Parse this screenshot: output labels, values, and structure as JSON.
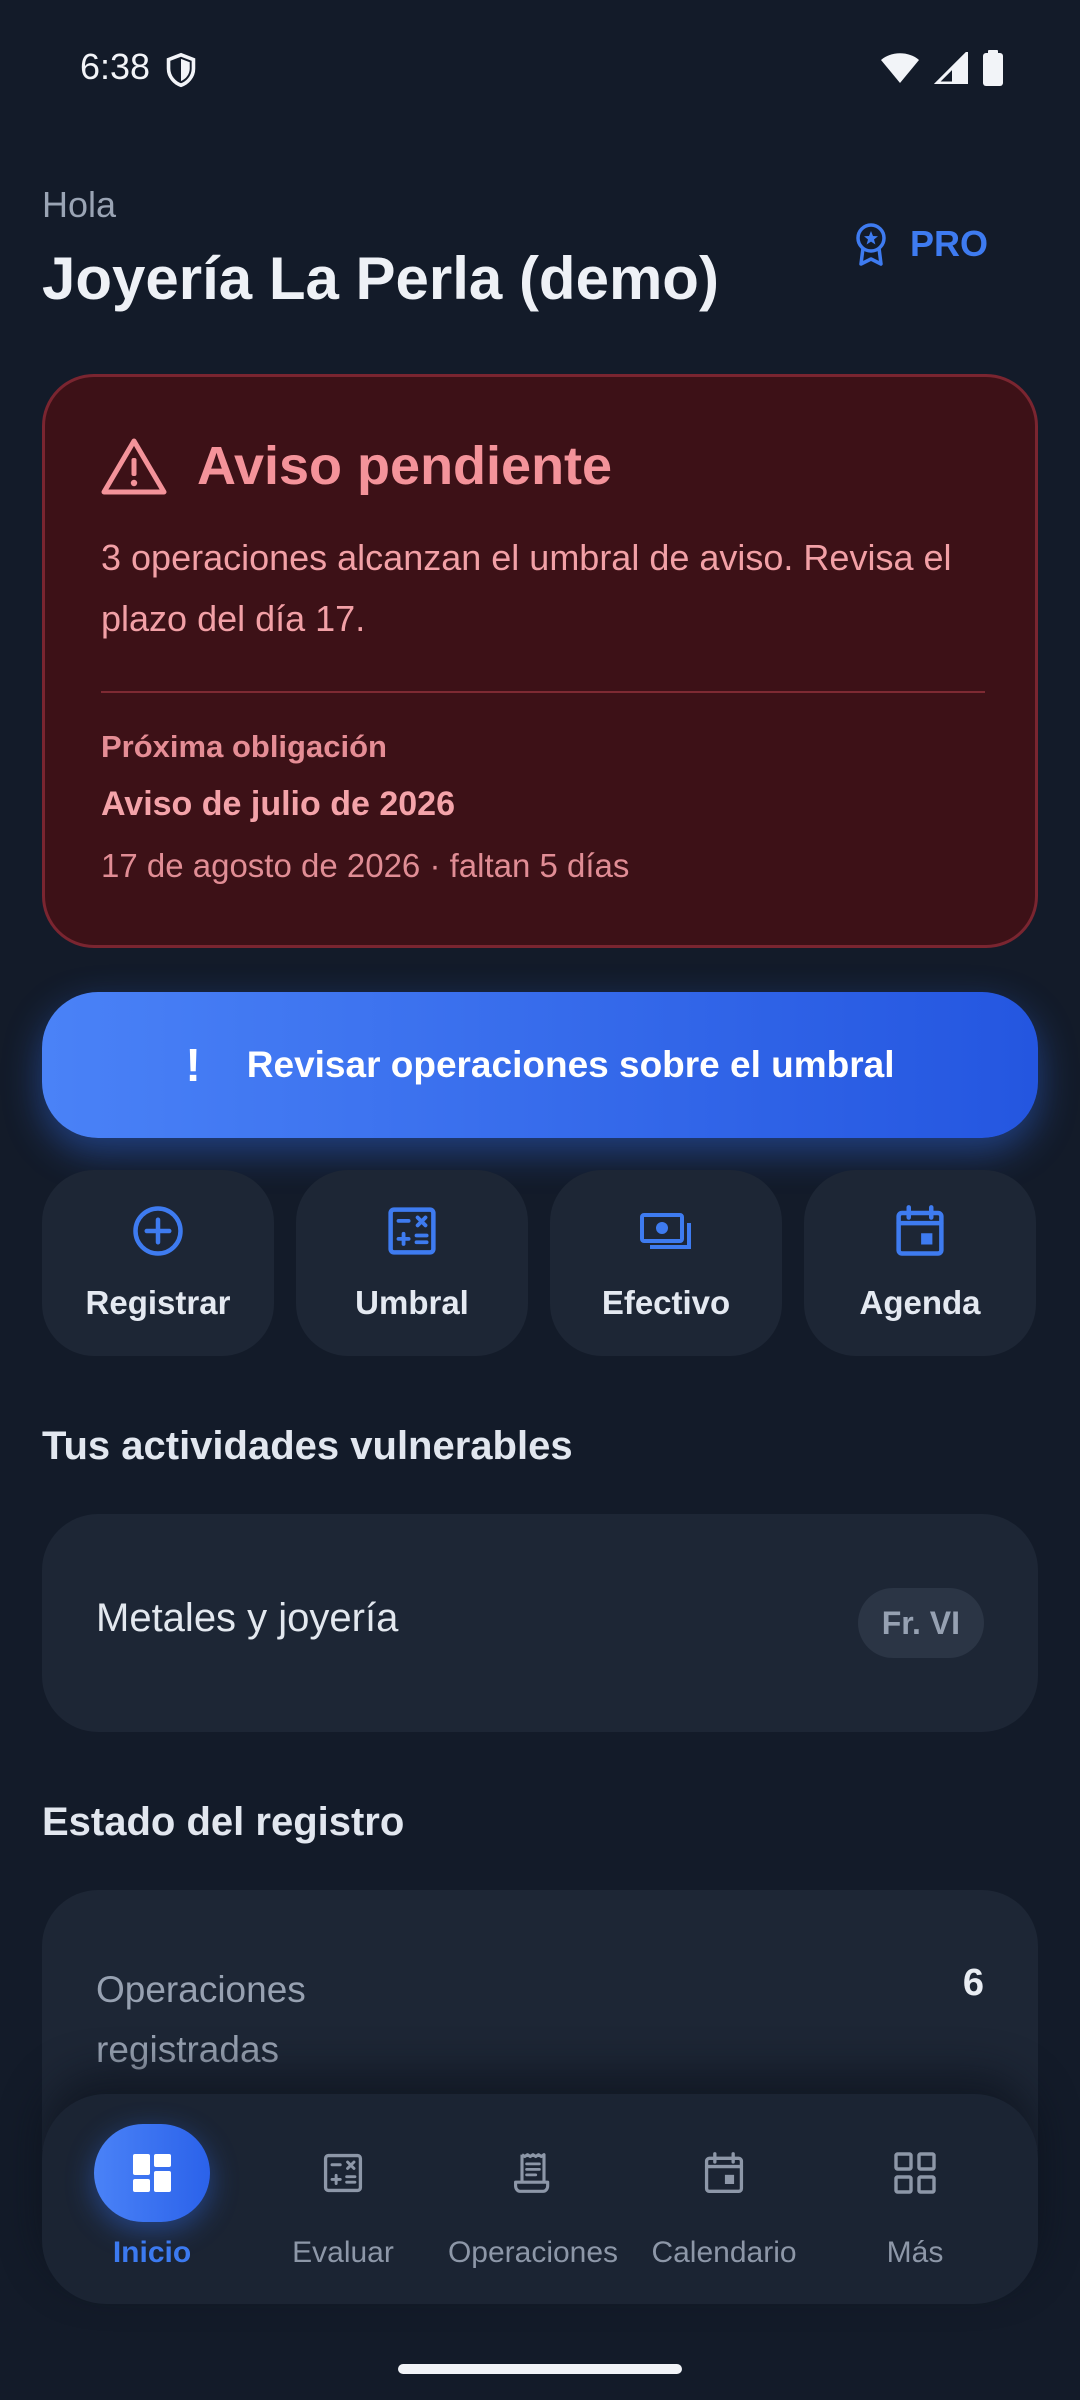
{
  "status_bar": {
    "time": "6:38"
  },
  "header": {
    "greeting": "Hola",
    "business_name": "Joyería La Perla (demo)",
    "pro_label": "PRO"
  },
  "alert": {
    "title": "Aviso pendiente",
    "body": "3 operaciones alcanzan el umbral de aviso. Revisa el plazo del día 17.",
    "next_label": "Próxima obligación",
    "next_title": "Aviso de julio de 2026",
    "next_date": "17 de agosto de 2026 · faltan 5 días"
  },
  "cta": {
    "icon": "!",
    "label": "Revisar operaciones sobre el umbral"
  },
  "quick_actions": [
    {
      "label": "Registrar",
      "icon": "plus-circle-icon"
    },
    {
      "label": "Umbral",
      "icon": "calculator-icon"
    },
    {
      "label": "Efectivo",
      "icon": "cash-icon"
    },
    {
      "label": "Agenda",
      "icon": "calendar-icon"
    }
  ],
  "activities": {
    "title": "Tus actividades vulnerables",
    "items": [
      {
        "name": "Metales y joyería",
        "chip": "Fr. VI"
      }
    ]
  },
  "registry": {
    "title": "Estado del registro",
    "rows": [
      {
        "label": "Operaciones registradas",
        "value": "6"
      }
    ]
  },
  "bottom_nav": {
    "items": [
      {
        "label": "Inicio",
        "icon": "dashboard-icon",
        "active": true
      },
      {
        "label": "Evaluar",
        "icon": "calculator-icon",
        "active": false
      },
      {
        "label": "Operaciones",
        "icon": "receipt-icon",
        "active": false
      },
      {
        "label": "Calendario",
        "icon": "calendar-icon",
        "active": false
      },
      {
        "label": "Más",
        "icon": "grid-icon",
        "active": false
      }
    ]
  },
  "colors": {
    "background": "#131b29",
    "accent": "#3e7bf0",
    "alert_bg": "#3d1117",
    "alert_text": "#f4939a",
    "card_bg": "#1d2635"
  }
}
